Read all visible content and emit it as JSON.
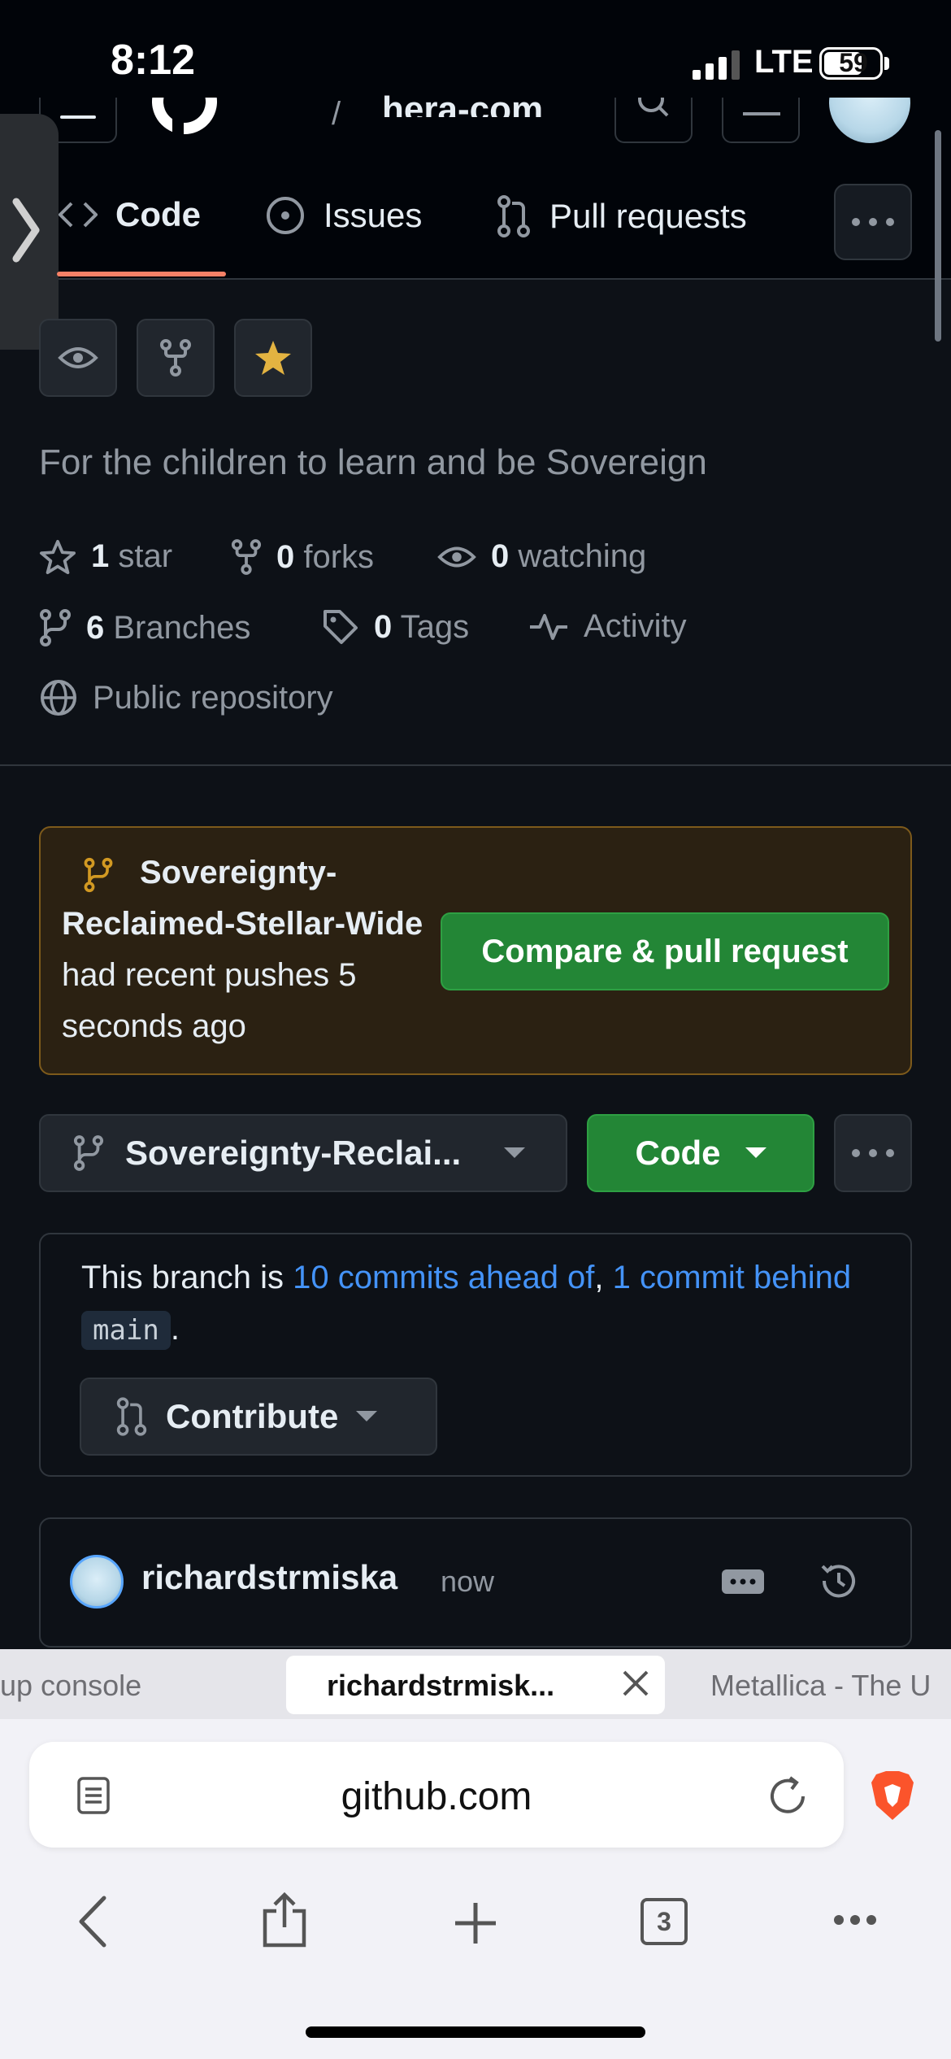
{
  "status_bar": {
    "time": "8:12",
    "network": "LTE",
    "battery": "59"
  },
  "header": {
    "repo_title_partial": "hera-com"
  },
  "repo_tabs": [
    {
      "label": "Code",
      "active": true
    },
    {
      "label": "Issues",
      "active": false
    },
    {
      "label": "Pull requests",
      "active": false
    }
  ],
  "repo": {
    "description": "For the children to learn and be Sovereign",
    "stars_count": "1",
    "stars_label": "star",
    "forks_count": "0",
    "forks_label": "forks",
    "watching_count": "0",
    "watching_label": "watching",
    "branches_count": "6",
    "branches_label": "Branches",
    "tags_count": "0",
    "tags_label": "Tags",
    "activity_label": "Activity",
    "visibility": "Public repository"
  },
  "push_banner": {
    "branch_name": "Sovereignty-Reclaimed-Stellar-Wide",
    "message": "had recent pushes 5 seconds ago",
    "compare_button": "Compare & pull request"
  },
  "branch_bar": {
    "selected_branch": "Sovereignty-Reclai...",
    "code_button": "Code"
  },
  "branch_status": {
    "prefix": "This branch is",
    "ahead": "10 commits ahead of",
    "separator": ",",
    "behind": "1 commit behind",
    "base": "main",
    "suffix": ".",
    "contribute_button": "Contribute"
  },
  "latest_commit": {
    "author": "richardstrmiska",
    "time": "now"
  },
  "browser": {
    "tabs": [
      {
        "label": "up console",
        "active": false
      },
      {
        "label": "richardstrmisk...",
        "active": true
      },
      {
        "label": "Metallica - The U",
        "active": false
      }
    ],
    "url": "github.com",
    "tab_count": "3"
  },
  "colors": {
    "background": "#0d1117",
    "accent_green": "#238636",
    "link_blue": "#4493f8",
    "tab_underline": "#f78166",
    "banner_bg": "#2b2112",
    "star_yellow": "#e3b341"
  }
}
